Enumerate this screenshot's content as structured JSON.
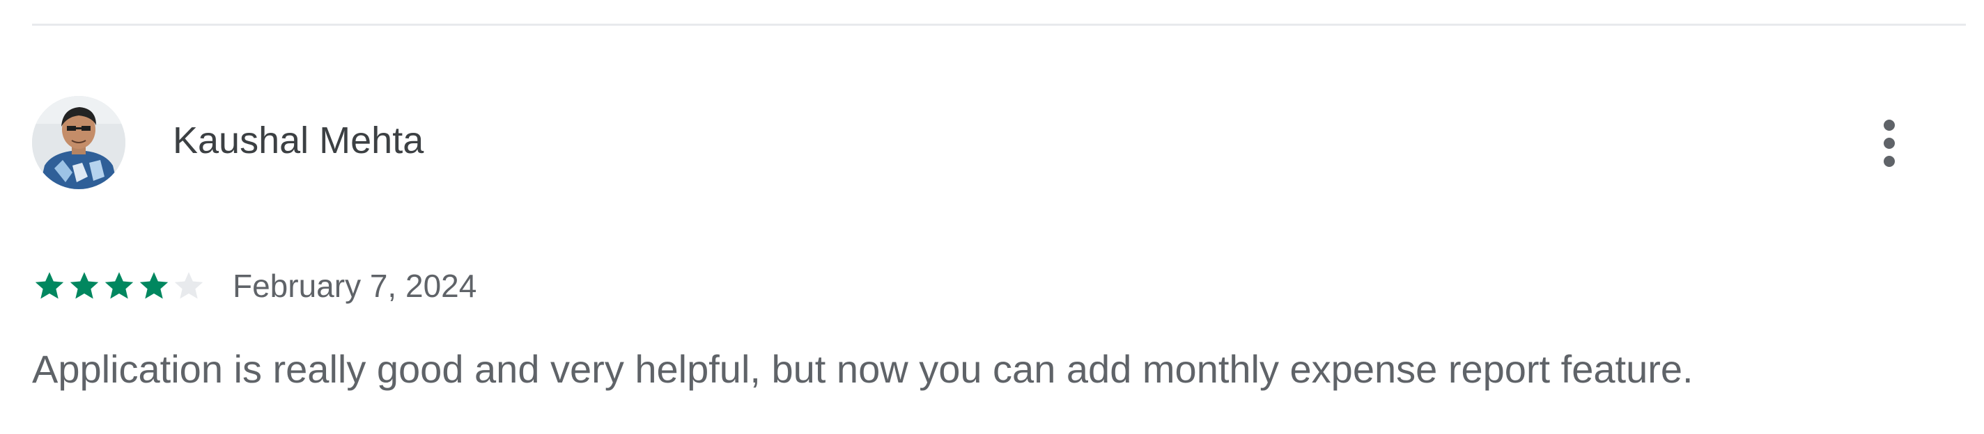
{
  "review": {
    "author_name": "Kaushal Mehta",
    "avatar_icon": "user-avatar-photo",
    "more_icon": "more-vert-icon",
    "rating": {
      "value": 4,
      "max": 5,
      "filled_color": "#01875f",
      "empty_color": "#e8eaed"
    },
    "date": "February 7, 2024",
    "text": "Application is really good and very helpful, but now you can add monthly expense report feature."
  }
}
